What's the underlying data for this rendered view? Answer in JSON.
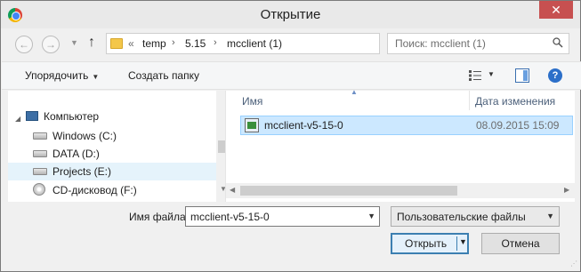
{
  "window": {
    "title": "Открытие",
    "close_glyph": "✕"
  },
  "nav": {
    "back_glyph": "←",
    "forward_glyph": "→",
    "recent_glyph": "▼",
    "up_glyph": "↑",
    "breadcrumb": {
      "overflow": "«",
      "items": [
        "temp",
        "5.15",
        "mcclient (1)"
      ],
      "separator": "›"
    },
    "dropdown_glyph": "▾",
    "refresh_glyph": "⟳"
  },
  "search": {
    "placeholder": "Поиск: mcclient (1)"
  },
  "toolbar": {
    "organize_label": "Упорядочить",
    "organize_arrow": "▼",
    "new_folder_label": "Создать папку",
    "view_dropdown": "▼",
    "help_glyph": "?"
  },
  "nav_pane": {
    "expand_glyph": "◢",
    "items": [
      {
        "label": "Компьютер",
        "icon": "computer-icon"
      },
      {
        "label": "Windows (C:)",
        "icon": "drive-icon"
      },
      {
        "label": "DATA (D:)",
        "icon": "drive-icon"
      },
      {
        "label": "Projects (E:)",
        "icon": "drive-icon"
      },
      {
        "label": "CD-дисковод (F:)",
        "icon": "disc-icon"
      }
    ],
    "scroll_down_glyph": "▼"
  },
  "file_list": {
    "columns": {
      "name": "Имя",
      "date": "Дата изменения"
    },
    "sort_arrow": "▲",
    "rows": [
      {
        "name": "mcclient-v5-15-0",
        "date": "08.09.2015 15:09",
        "icon": "executable-icon"
      }
    ],
    "scroll_left_glyph": "◀",
    "scroll_right_glyph": "▶"
  },
  "footer": {
    "filename_label": "Имя файла:",
    "filename_value": "mcclient-v5-15-0",
    "filename_dd": "▼",
    "filter_value": "Пользовательские файлы",
    "filter_dd": "▼",
    "open_label": "Открыть",
    "open_dd": "▼",
    "cancel_label": "Отмена",
    "grip_glyph": "⋰"
  }
}
